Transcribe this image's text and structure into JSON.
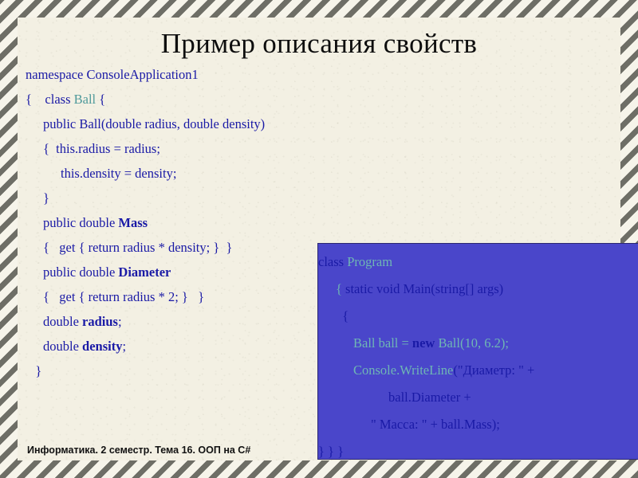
{
  "slide": {
    "title": "Пример описания свойств",
    "footer": "Информатика. 2 семестр. Тема 16. ООП на C#",
    "colors": {
      "paper": "#f3f0e3",
      "frame_stripe": "#6e6e66",
      "code_blue": "#1a1aa6",
      "code_teal": "#4f9a9b",
      "panel_background": "#4a46ca",
      "panel_border": "#2b2770",
      "panel_teal": "#6fb6b4",
      "title": "#0d0d0d"
    }
  },
  "code_left": {
    "language": "csharp",
    "lines": [
      {
        "indent": 0,
        "segments": [
          {
            "text": "namespace ConsoleApplication1",
            "style": "plain"
          }
        ]
      },
      {
        "indent": 0,
        "segments": [
          {
            "text": "{    class ",
            "style": "plain"
          },
          {
            "text": "Ball",
            "style": "teal"
          },
          {
            "text": " {",
            "style": "plain"
          }
        ]
      },
      {
        "indent": 1,
        "segments": [
          {
            "text": "public Ball(double radius, double density)",
            "style": "plain"
          }
        ]
      },
      {
        "indent": 1,
        "segments": [
          {
            "text": "{  this.radius = radius;",
            "style": "plain"
          }
        ]
      },
      {
        "indent": 2,
        "segments": [
          {
            "text": "this.density = density;",
            "style": "plain"
          }
        ]
      },
      {
        "indent": 1,
        "segments": [
          {
            "text": "}",
            "style": "plain"
          }
        ]
      },
      {
        "indent": 1,
        "segments": [
          {
            "text": "public double ",
            "style": "plain"
          },
          {
            "text": "Mass",
            "style": "bold"
          }
        ]
      },
      {
        "indent": 1,
        "segments": [
          {
            "text": "{   get { return radius * density; }  }",
            "style": "plain"
          }
        ]
      },
      {
        "indent": 1,
        "segments": [
          {
            "text": "public double ",
            "style": "plain"
          },
          {
            "text": "Diameter",
            "style": "bold"
          }
        ]
      },
      {
        "indent": 1,
        "segments": [
          {
            "text": "{   get { return radius * 2; }   }",
            "style": "plain"
          }
        ]
      },
      {
        "indent": 1,
        "segments": [
          {
            "text": "double ",
            "style": "plain"
          },
          {
            "text": "radius",
            "style": "bold"
          },
          {
            "text": ";",
            "style": "plain"
          }
        ]
      },
      {
        "indent": 1,
        "segments": [
          {
            "text": "double ",
            "style": "plain"
          },
          {
            "text": "density",
            "style": "bold"
          },
          {
            "text": ";",
            "style": "plain"
          }
        ]
      },
      {
        "indent": 0,
        "segments": [
          {
            "text": "   }",
            "style": "plain"
          }
        ]
      }
    ]
  },
  "code_right": {
    "language": "csharp",
    "lines": [
      {
        "indent": 0,
        "segments": [
          {
            "text": "class ",
            "style": "plain"
          },
          {
            "text": "Program",
            "style": "teal"
          }
        ]
      },
      {
        "indent": 1,
        "segments": [
          {
            "text": "{",
            "style": "teal"
          },
          {
            "text": " static void Main(string[] args)",
            "style": "plain"
          }
        ]
      },
      {
        "indent": 1,
        "segments": [
          {
            "text": "  {",
            "style": "plain"
          }
        ]
      },
      {
        "indent": 2,
        "segments": [
          {
            "text": "Ball ball = ",
            "style": "teal"
          },
          {
            "text": "new",
            "style": "bold"
          },
          {
            "text": " Ball(10, 6.2);",
            "style": "teal"
          }
        ]
      },
      {
        "indent": 2,
        "segments": [
          {
            "text": "Console.WriteLine",
            "style": "teal"
          },
          {
            "text": "(\"Диаметр: \" +",
            "style": "plain"
          }
        ]
      },
      {
        "indent": 4,
        "segments": [
          {
            "text": "ball.Diameter +",
            "style": "plain"
          }
        ]
      },
      {
        "indent": 3,
        "segments": [
          {
            "text": "\" Масса: \" + ball.Mass);",
            "style": "plain"
          }
        ]
      },
      {
        "indent": 0,
        "segments": [
          {
            "text": "} } }",
            "style": "plain"
          }
        ]
      }
    ]
  }
}
